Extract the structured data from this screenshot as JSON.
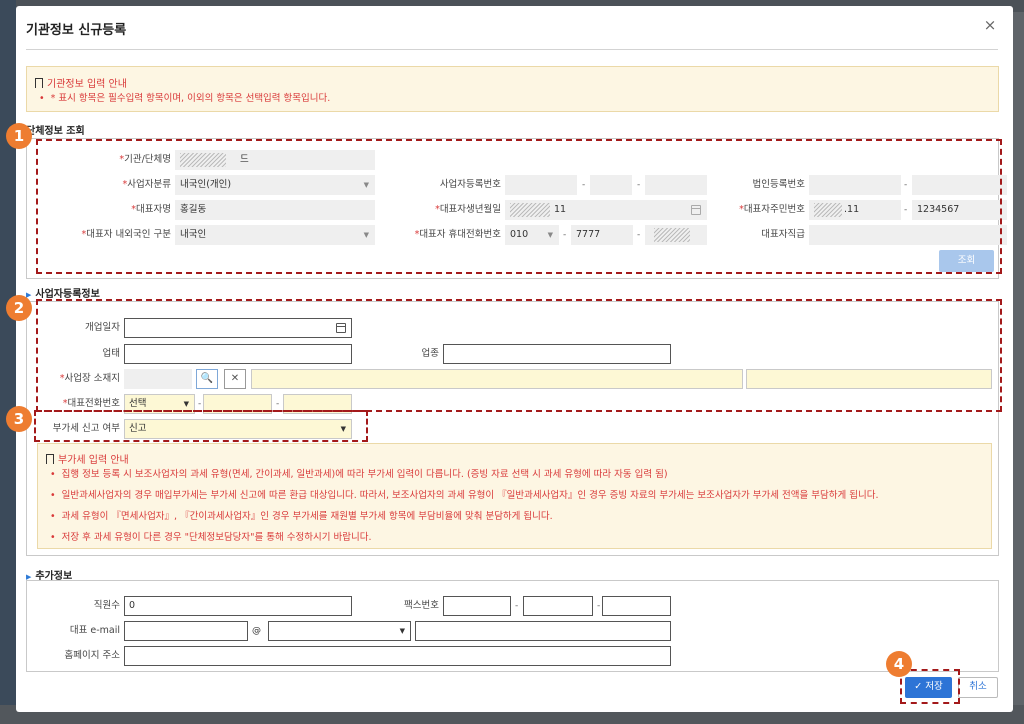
{
  "modal": {
    "title": "기관정보 신규등록",
    "close": "×"
  },
  "notice_top": {
    "title": "기관정보 입력 안내",
    "items": [
      "* 표시 항목은 필수입력 항목이며, 이외의 항목은 선택입력 항목입니다."
    ]
  },
  "org_section": {
    "heading": "단체정보 조회",
    "org_name": {
      "label": "기관/단체명",
      "value": "드"
    },
    "biz_type": {
      "label": "사업자분류",
      "value": "내국인(개인)"
    },
    "rep_name": {
      "label": "대표자명",
      "value": "홍길동"
    },
    "nationality": {
      "label": "대표자 내외국인 구분",
      "value": "내국인"
    },
    "biz_reg_no": {
      "label": "사업자등록번호"
    },
    "rep_birth": {
      "label": "대표자생년월일",
      "value": "11"
    },
    "rep_phone": {
      "label": "대표자 휴대전화번호",
      "p1": "010",
      "p2": "7777"
    },
    "corp_reg_no": {
      "label": "법인등록번호"
    },
    "rep_rrn": {
      "label": "대표자주민번호",
      "p1": ".11",
      "p2": "1234567"
    },
    "rep_position": {
      "label": "대표자직급"
    },
    "search_button": "조회"
  },
  "biz_section": {
    "heading": "사업자등록정보",
    "open_date": {
      "label": "개업일자"
    },
    "business": {
      "label": "업태"
    },
    "industry": {
      "label": "업종"
    },
    "address": {
      "label": "사업장 소재지",
      "search_icon": "🔍",
      "clear_icon": "✕"
    },
    "phone": {
      "label": "대표전화번호",
      "select": "선택"
    }
  },
  "vat": {
    "label": "부가세 신고 여부",
    "value": "신고"
  },
  "notice_vat": {
    "title": "부가세 입력 안내",
    "items": [
      "집행 정보 등록 시 보조사업자의 과세 유형(면세, 간이과세, 일반과세)에 따라 부가세 입력이 다릅니다. (증빙 자료 선택 시 과세 유형에 따라 자동 입력 됨)",
      "일반과세사업자의 경우 매입부가세는 부가세 신고에 따른 환급 대상입니다. 따라서, 보조사업자의 과세 유형이 『일반과세사업자』인 경우 증빙 자료의 부가세는 보조사업자가 부가세 전액을 부담하게 됩니다.",
      "과세 유형이 『면세사업자』, 『간이과세사업자』인 경우 부가세를 재원별 부가세 항목에 부담비율에 맞춰 분담하게 됩니다.",
      "저장 후 과세 유형이 다른 경우 \"단체정보담당자\"를 통해 수정하시기 바랍니다."
    ]
  },
  "extra_section": {
    "heading": "추가정보",
    "staff": {
      "label": "직원수",
      "value": "0"
    },
    "fax": {
      "label": "팩스번호"
    },
    "email": {
      "label": "대표 e-mail",
      "at": "@"
    },
    "homepage": {
      "label": "홈페이지 주소"
    }
  },
  "footer": {
    "save": "저장",
    "cancel": "취소"
  },
  "markers": [
    "1",
    "2",
    "3",
    "4"
  ],
  "colors": {
    "accent": "#2d74d6",
    "required": "#d93a3a",
    "annotation": "#a3191a",
    "marker": "#ee7d31",
    "notice_bg": "#fdf6e3"
  }
}
